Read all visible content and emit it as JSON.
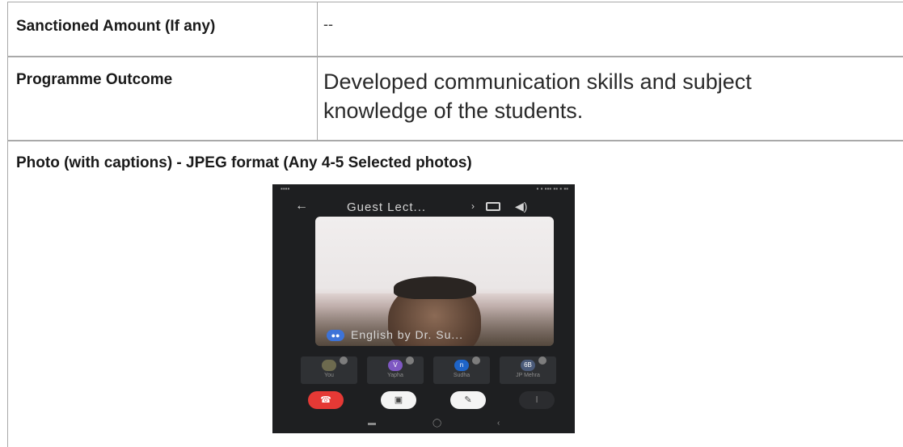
{
  "rows": {
    "sanctioned": {
      "label": "Sanctioned Amount (If any)",
      "value": "--"
    },
    "outcome": {
      "label": "Programme Outcome",
      "value_line1": "Developed communication skills and subject",
      "value_line2": "knowledge of the students."
    },
    "photo": {
      "label": "Photo (with captions) - JPEG format (Any 4-5 Selected photos)"
    }
  },
  "phone": {
    "topbar": {
      "title": "Guest Lect...",
      "back_icon": "arrow-left-icon",
      "switch_icon": "switch-camera-icon",
      "speaker_icon": "speaker-icon"
    },
    "caption": "English by Dr. Su...",
    "participants": [
      {
        "initials": "",
        "name": "You",
        "color": "#6d6a4e"
      },
      {
        "initials": "V",
        "name": "Yapha",
        "color": "#7e57c2"
      },
      {
        "initials": "n",
        "name": "Sudha",
        "color": "#1e64c8"
      },
      {
        "initials": "6B",
        "name": "JP Mehra",
        "color": "#4b5b7a"
      }
    ],
    "controls": {
      "end_icon": "end-call-icon",
      "camera_icon": "camera-off-icon",
      "mic_icon": "mic-off-icon",
      "hand_icon": "raise-hand-icon"
    },
    "colors": {
      "end_call": "#e53935",
      "caption_badge": "#3d73d8",
      "background": "#1e1f21"
    }
  }
}
